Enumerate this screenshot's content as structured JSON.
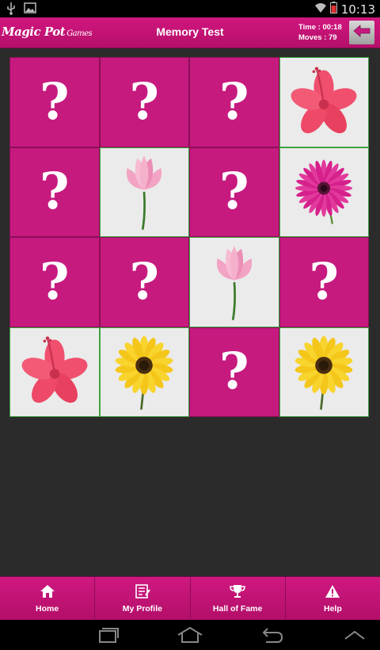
{
  "status_bar": {
    "time": "10:13",
    "left_icons": [
      "usb-icon",
      "image-icon"
    ],
    "right_icons": [
      "wifi-icon",
      "battery-icon"
    ]
  },
  "header": {
    "logo_main": "Magic Pot",
    "logo_sub": "Games",
    "title": "Memory Test",
    "time_text": "Time : 00:18",
    "moves_text": "Moves : 79",
    "back_icon": "back-arrow-icon"
  },
  "board": {
    "hidden_symbol": "?",
    "cards": [
      {
        "state": "hidden"
      },
      {
        "state": "hidden"
      },
      {
        "state": "hidden"
      },
      {
        "state": "revealed",
        "flower": "hibiscus"
      },
      {
        "state": "hidden"
      },
      {
        "state": "revealed",
        "flower": "lotus"
      },
      {
        "state": "hidden"
      },
      {
        "state": "revealed",
        "flower": "daisy"
      },
      {
        "state": "hidden"
      },
      {
        "state": "hidden"
      },
      {
        "state": "revealed",
        "flower": "lotus"
      },
      {
        "state": "hidden"
      },
      {
        "state": "revealed",
        "flower": "hibiscus"
      },
      {
        "state": "revealed",
        "flower": "sunflower"
      },
      {
        "state": "hidden"
      },
      {
        "state": "revealed",
        "flower": "sunflower"
      }
    ]
  },
  "bottom_nav": {
    "items": [
      {
        "label": "Home",
        "icon": "home-icon"
      },
      {
        "label": "My Profile",
        "icon": "profile-icon"
      },
      {
        "label": "Hall of Fame",
        "icon": "trophy-icon"
      },
      {
        "label": "Help",
        "icon": "warning-icon"
      }
    ]
  },
  "system_nav": [
    "recent-apps-icon",
    "home-icon",
    "back-icon",
    "collapse-icon"
  ],
  "colors": {
    "accent": "#c61a7f",
    "background": "#2b2b2b",
    "card_revealed": "#ebebeb",
    "card_border_revealed": "#3fa33f"
  }
}
